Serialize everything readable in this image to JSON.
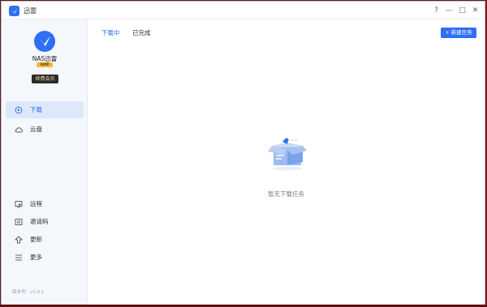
{
  "window": {
    "title": "迅雷"
  },
  "window_controls": {
    "help": "?",
    "minimize": "—",
    "maximize": "□",
    "close": "✕"
  },
  "user": {
    "name": "NAS迅雷",
    "vip_badge": "SVIP",
    "renew_label": "续费会员"
  },
  "sidebar": {
    "top_items": [
      {
        "label": "下载",
        "icon": "download-circle-icon",
        "active": true
      },
      {
        "label": "云盘",
        "icon": "cloud-icon",
        "active": false
      }
    ],
    "bottom_items": [
      {
        "label": "远程",
        "icon": "remote-icon"
      },
      {
        "label": "邀请码",
        "icon": "invite-code-icon"
      },
      {
        "label": "更新",
        "icon": "update-arrow-icon"
      },
      {
        "label": "更多",
        "icon": "menu-icon"
      }
    ],
    "version": "版本号：v1.0.1"
  },
  "tabs": [
    {
      "label": "下载中",
      "active": true
    },
    {
      "label": "已完成",
      "active": false
    }
  ],
  "new_task_label": "新建任务",
  "empty_state": {
    "text": "暂无下载任务"
  },
  "colors": {
    "accent": "#2f6ff5",
    "sidebar_bg": "#f4f7fb",
    "active_nav_bg": "#dde8fb"
  }
}
